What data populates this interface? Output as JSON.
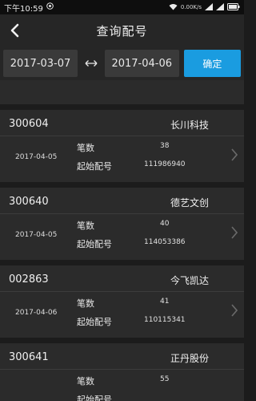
{
  "status": {
    "time": "下午10:59",
    "right_text": "0.00K/s",
    "battery": ""
  },
  "header": {
    "title": "查询配号"
  },
  "dates": {
    "start": "2017-03-07",
    "end": "2017-04-06",
    "confirm_label": "确定"
  },
  "labels": {
    "count": "笔数",
    "start_no": "起始配号"
  },
  "records": [
    {
      "code": "300604",
      "name": "长川科技",
      "date": "2017-04-05",
      "count": "38",
      "start_no": "111986940"
    },
    {
      "code": "300640",
      "name": "德艺文创",
      "date": "2017-04-05",
      "count": "40",
      "start_no": "114053386"
    },
    {
      "code": "002863",
      "name": "今飞凯达",
      "date": "2017-04-06",
      "count": "41",
      "start_no": "110115341"
    },
    {
      "code": "300641",
      "name": "正丹股份",
      "date": "",
      "count": "55",
      "start_no": ""
    }
  ],
  "colors": {
    "accent": "#1a9ce0",
    "background": "#1c1c1c",
    "card": "#2b2b2b"
  }
}
